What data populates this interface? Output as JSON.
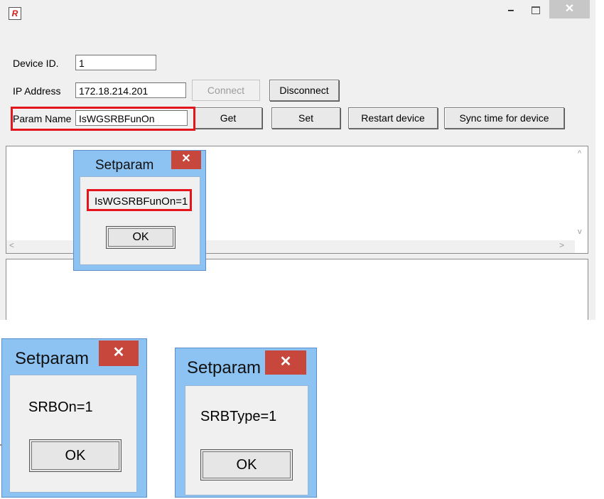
{
  "window": {
    "app_icon": "app-logo-icon",
    "app_icon_glyph": "R",
    "minimize": "–",
    "close": "✕"
  },
  "form": {
    "device_id_label": "Device ID.",
    "device_id_value": "1",
    "ip_label": "IP Address",
    "ip_value": "172.18.214.201",
    "param_label": "Param Name",
    "param_value": "IsWGSRBFunOn"
  },
  "buttons": {
    "connect": "Connect",
    "disconnect": "Disconnect",
    "get": "Get",
    "set": "Set",
    "restart": "Restart device",
    "sync_time": "Sync time for device"
  },
  "scroll": {
    "up": "^",
    "down": "v",
    "left": "<",
    "right": ">"
  },
  "dialogs": [
    {
      "title": "Setparam",
      "close": "✕",
      "message": "IsWGSRBFunOn=1",
      "ok": "OK"
    },
    {
      "title": "Setparam",
      "close": "✕",
      "message": "SRBOn=1",
      "ok": "OK"
    },
    {
      "title": "Setparam",
      "close": "✕",
      "message": "SRBType=1",
      "ok": "OK"
    }
  ],
  "colors": {
    "highlight": "#e4151d",
    "dialog_frame": "#8dc3f3",
    "dialog_close": "#c8473d",
    "window_bg": "#f0f0f0"
  }
}
